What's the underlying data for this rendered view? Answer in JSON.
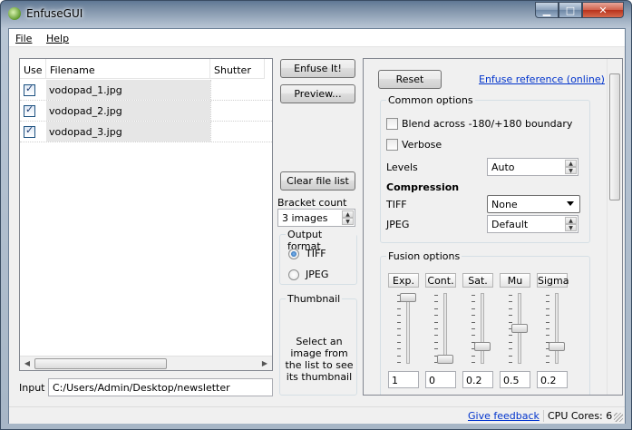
{
  "window": {
    "title": "EnfuseGUI"
  },
  "menu": {
    "file": "File",
    "help": "Help"
  },
  "files": {
    "headers": {
      "use": "Use",
      "filename": "Filename",
      "shutter": "Shutter"
    },
    "rows": [
      {
        "checked": true,
        "name": "vodopad_1.jpg",
        "shutter": ""
      },
      {
        "checked": true,
        "name": "vodopad_2.jpg",
        "shutter": ""
      },
      {
        "checked": true,
        "name": "vodopad_3.jpg",
        "shutter": ""
      }
    ]
  },
  "input": {
    "label": "Input",
    "value": "C:/Users/Admin/Desktop/newsletter"
  },
  "actions": {
    "enfuse": "Enfuse It!",
    "preview": "Preview...",
    "clear": "Clear file list",
    "bracket_label": "Bracket count",
    "bracket_value": "3 images"
  },
  "output": {
    "title": "Output format",
    "options": [
      "TIFF",
      "JPEG"
    ],
    "selected": "TIFF"
  },
  "thumbnail": {
    "title": "Thumbnail",
    "message": "Select an image from the list to see its thumbnail"
  },
  "options": {
    "reset": "Reset",
    "reference_link": "Enfuse reference (online)",
    "common_title": "Common options",
    "blend": "Blend across -180/+180 boundary",
    "verbose": "Verbose",
    "levels_label": "Levels",
    "levels_value": "Auto",
    "compression_title": "Compression",
    "tiff_label": "TIFF",
    "tiff_value": "None",
    "jpeg_label": "JPEG",
    "jpeg_value": "Default",
    "fusion_title": "Fusion options",
    "sliders": [
      {
        "label": "Exp.",
        "value": "1",
        "level": 1.0
      },
      {
        "label": "Cont.",
        "value": "0",
        "level": 0.0
      },
      {
        "label": "Sat.",
        "value": "0.2",
        "level": 0.2
      },
      {
        "label": "Mu",
        "value": "0.5",
        "level": 0.5
      },
      {
        "label": "Sigma",
        "value": "0.2",
        "level": 0.2
      }
    ]
  },
  "status": {
    "feedback": "Give feedback",
    "cpu": "CPU Cores: 6"
  }
}
